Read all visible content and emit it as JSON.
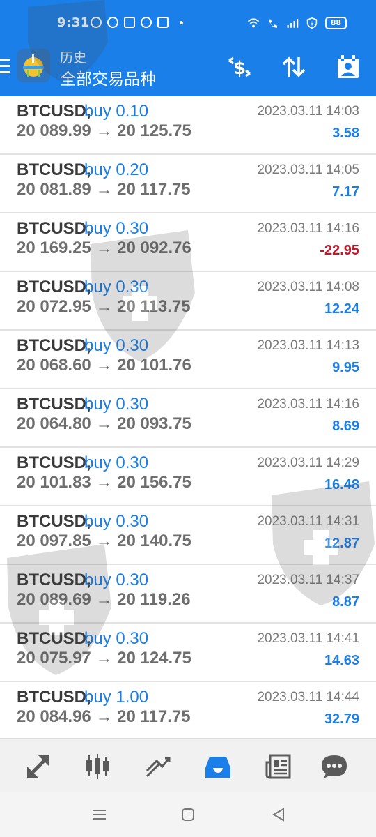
{
  "status_bar": {
    "time": "9:31",
    "battery": "88",
    "app_icons": [
      "whatsapp-icon",
      "messenger-icon",
      "shopping-icon",
      "facebook-icon",
      "app-icon"
    ]
  },
  "app_bar": {
    "title": "历史",
    "subtitle": "全部交易品种",
    "accent_color": "#1a7fe8"
  },
  "trades": [
    {
      "symbol": "BTCUSD,",
      "side": "buy 0.10",
      "prices": "20 089.99 → 20 125.75",
      "time": "2023.03.11 14:03",
      "profit": "3.58"
    },
    {
      "symbol": "BTCUSD,",
      "side": "buy 0.20",
      "prices": "20 081.89 → 20 117.75",
      "time": "2023.03.11 14:05",
      "profit": "7.17"
    },
    {
      "symbol": "BTCUSD,",
      "side": "buy 0.30",
      "prices": "20 169.25 → 20 092.76",
      "time": "2023.03.11 14:16",
      "profit": "-22.95"
    },
    {
      "symbol": "BTCUSD,",
      "side": "buy 0.30",
      "prices": "20 072.95 → 20 113.75",
      "time": "2023.03.11 14:08",
      "profit": "12.24"
    },
    {
      "symbol": "BTCUSD,",
      "side": "buy 0.30",
      "prices": "20 068.60 → 20 101.76",
      "time": "2023.03.11 14:13",
      "profit": "9.95"
    },
    {
      "symbol": "BTCUSD,",
      "side": "buy 0.30",
      "prices": "20 064.80 → 20 093.75",
      "time": "2023.03.11 14:16",
      "profit": "8.69"
    },
    {
      "symbol": "BTCUSD,",
      "side": "buy 0.30",
      "prices": "20 101.83 → 20 156.75",
      "time": "2023.03.11 14:29",
      "profit": "16.48"
    },
    {
      "symbol": "BTCUSD,",
      "side": "buy 0.30",
      "prices": "20 097.85 → 20 140.75",
      "time": "2023.03.11 14:31",
      "profit": "12.87"
    },
    {
      "symbol": "BTCUSD,",
      "side": "buy 0.30",
      "prices": "20 089.69 → 20 119.26",
      "time": "2023.03.11 14:37",
      "profit": "8.87"
    },
    {
      "symbol": "BTCUSD,",
      "side": "buy 0.30",
      "prices": "20 075.97 → 20 124.75",
      "time": "2023.03.11 14:41",
      "profit": "14.63"
    },
    {
      "symbol": "BTCUSD,",
      "side": "buy 1.00",
      "prices": "20 084.96 → 20 117.75",
      "time": "2023.03.11 14:44",
      "profit": "32.79"
    }
  ],
  "colors": {
    "profit_positive": "#1a7fe8",
    "profit_negative": "#c0182a"
  },
  "bottom_nav": [
    {
      "icon": "quotes-icon"
    },
    {
      "icon": "chart-icon"
    },
    {
      "icon": "trade-icon"
    },
    {
      "icon": "history-icon",
      "active": true
    },
    {
      "icon": "news-icon"
    },
    {
      "icon": "messages-icon"
    }
  ]
}
